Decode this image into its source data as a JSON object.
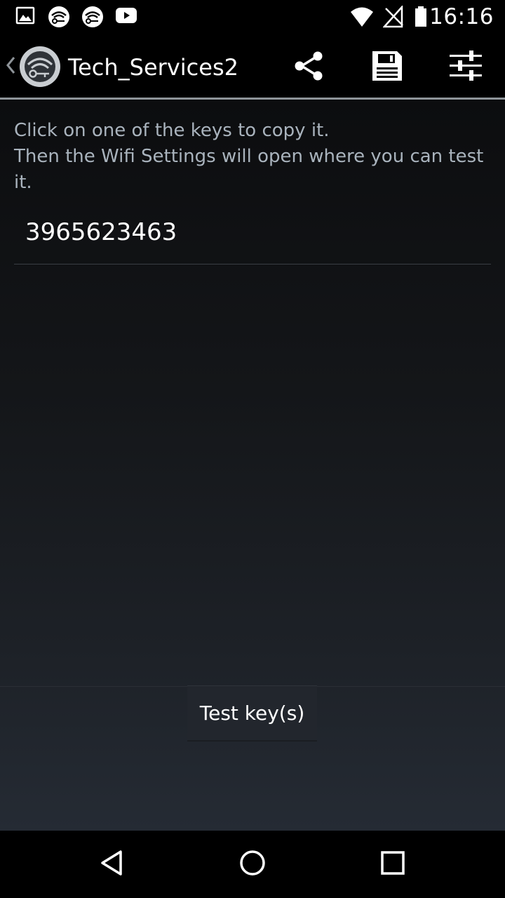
{
  "status_bar": {
    "time": "16:16",
    "icons": [
      "image-icon",
      "wifi-key-icon",
      "wifi-key-icon",
      "youtube-icon",
      "wifi-signal-icon",
      "no-cell-signal-icon",
      "battery-icon"
    ]
  },
  "action_bar": {
    "title": "Tech_Services2",
    "actions": [
      "share-icon",
      "save-icon",
      "settings-sliders-icon"
    ]
  },
  "instructions": {
    "line1": "Click on one of the keys to copy it.",
    "line2": "Then the Wifi Settings will open where you can test it."
  },
  "keys": [
    {
      "value": "3965623463"
    }
  ],
  "test_button": {
    "label": "Test key(s)"
  },
  "nav_bar": {
    "buttons": [
      "back-icon",
      "home-icon",
      "recents-icon"
    ]
  },
  "colors": {
    "background_top": "#0c0d0f",
    "background_bottom": "#252b34",
    "instruction_text": "#a9b3bd",
    "divider": "#8e9499"
  }
}
